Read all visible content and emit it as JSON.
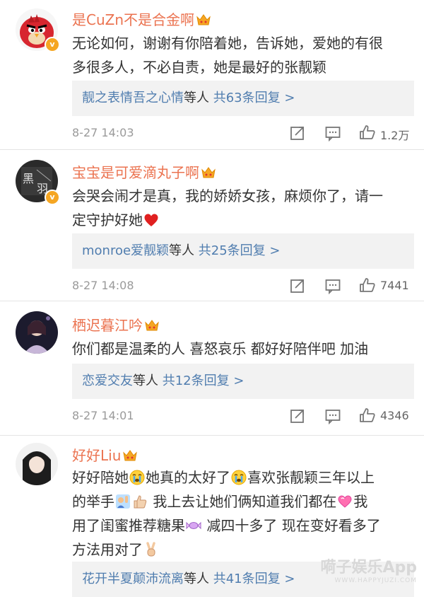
{
  "colors": {
    "username": "#eb7350",
    "link": "#507daf",
    "meta": "#9a9a9a",
    "reply_bg": "#f2f2f2"
  },
  "comments": [
    {
      "username": "是CuZn不是合金啊",
      "text_lines": [
        "无论如何，谢谢有你陪着她，告诉她，爱她的有很",
        "多很多人，不必自责，她是最好的张靓颖"
      ],
      "reply": {
        "users": "靓之表情吾之心情",
        "mid": "等人",
        "count": "共63条回复 >"
      },
      "time": "8-27 14:03",
      "likes": "1.2万"
    },
    {
      "username": "宝宝是可爱滴丸子啊",
      "text_lines": [
        "会哭会闹才是真，我的娇娇女孩，麻烦你了，请一",
        "定守护好她"
      ],
      "reply": {
        "users": "monroe爱靓颖",
        "mid": "等人",
        "count": "共25条回复 >"
      },
      "time": "8-27 14:08",
      "likes": "7441"
    },
    {
      "username": "栖迟暮江吟",
      "text_lines": [
        "你们都是温柔的人 喜怒哀乐 都好好陪伴吧 加油"
      ],
      "reply": {
        "users": "恋爱交友",
        "mid": "等人",
        "count": "共12条回复 >"
      },
      "time": "8-27 14:01",
      "likes": "4346"
    },
    {
      "username": "好好Liu",
      "text_parts": {
        "l1a": "好好陪她",
        "l1b": "她真的太好了",
        "l1c": "喜欢张靓颖三年以上",
        "l2a": "的举手",
        "l2b": " 我上去让她们俩知道我们都在",
        "l2c": "我",
        "l3a": "用了闺蜜推荐糖果",
        "l3b": " 减四十多了 现在变好看多了",
        "l4a": "方法用对了"
      },
      "reply": {
        "users": "花开半夏颠沛流离",
        "mid": "等人",
        "count": "共41条回复 >"
      }
    }
  ],
  "watermark": {
    "main": "嗬子娱乐App",
    "sub": "WWW.HAPPYJUZI.COM"
  },
  "icons": [
    "repost-icon",
    "comment-icon",
    "like-icon",
    "verified-badge-icon",
    "vip-crown-icon"
  ]
}
